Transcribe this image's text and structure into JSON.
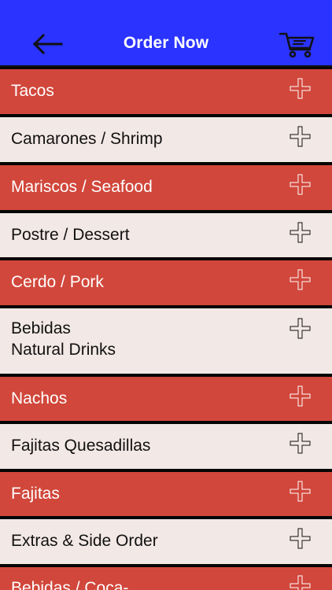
{
  "header": {
    "title": "Order Now",
    "back_icon": "back-arrow-icon",
    "cart_icon": "shopping-cart-icon",
    "background_color": "#2a33ff",
    "title_color": "#ffffff"
  },
  "menu": {
    "items": [
      {
        "label": "Tacos",
        "style": "red"
      },
      {
        "label": "Camarones / Shrimp",
        "style": "light"
      },
      {
        "label": "Mariscos / Seafood",
        "style": "red"
      },
      {
        "label": "Postre / Dessert",
        "style": "light"
      },
      {
        "label": "Cerdo / Pork",
        "style": "red"
      },
      {
        "label": "Bebidas\nNatural Drinks",
        "style": "light"
      },
      {
        "label": "Nachos",
        "style": "red"
      },
      {
        "label": "Fajitas Quesadillas",
        "style": "light"
      },
      {
        "label": "Fajitas",
        "style": "red"
      },
      {
        "label": "Extras & Side Order",
        "style": "light"
      },
      {
        "label": "Bebidas / Coca-",
        "style": "red"
      }
    ],
    "plus_icon": "plus-icon",
    "red_row_color": "#d1473b",
    "light_row_color": "#f2e8e5"
  }
}
